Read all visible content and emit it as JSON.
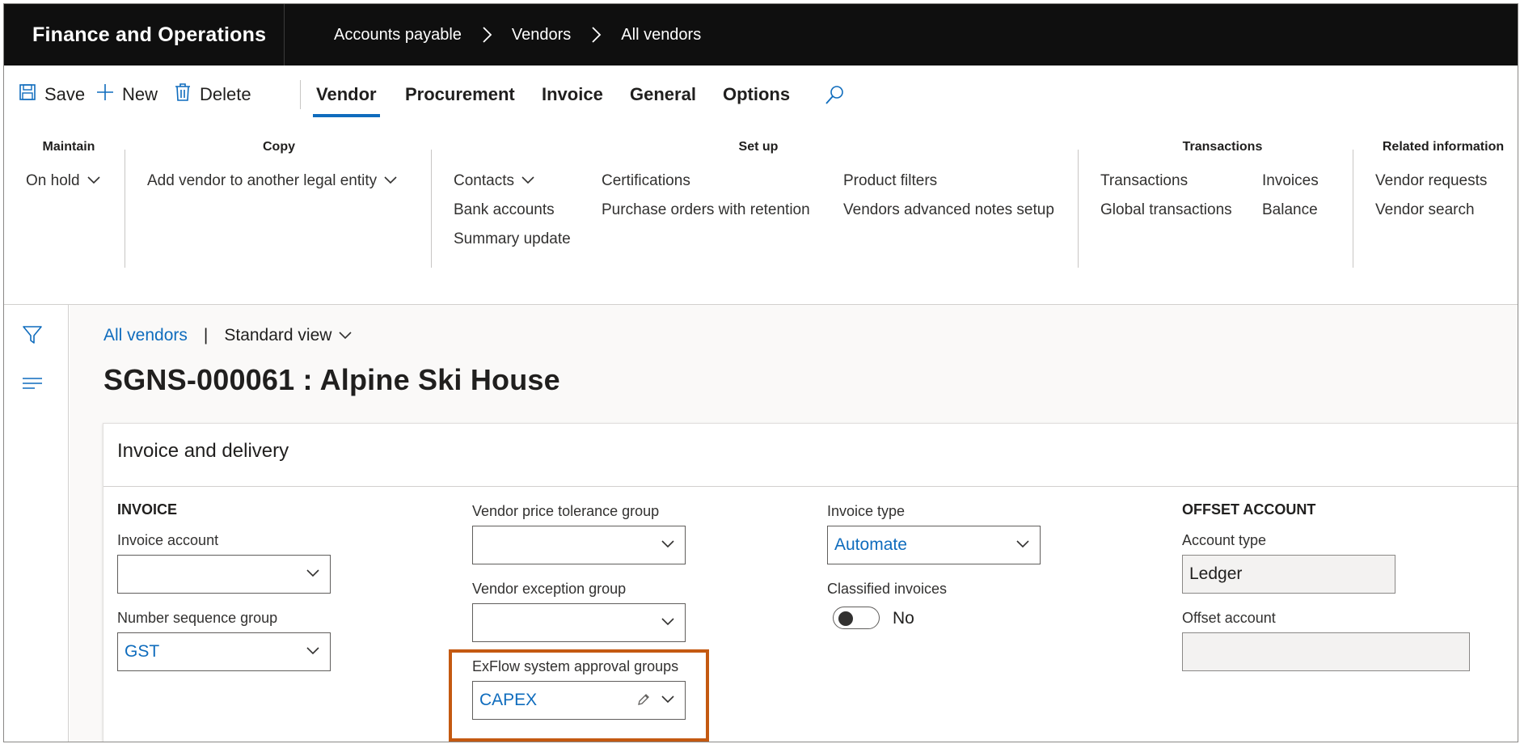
{
  "app": {
    "title": "Finance and Operations"
  },
  "breadcrumb": [
    "Accounts payable",
    "Vendors",
    "All vendors"
  ],
  "actions": {
    "save": "Save",
    "new": "New",
    "delete": "Delete"
  },
  "tabs": [
    "Vendor",
    "Procurement",
    "Invoice",
    "General",
    "Options"
  ],
  "active_tab": "Vendor",
  "ribbon": {
    "maintain": {
      "title": "Maintain",
      "items": [
        "On hold"
      ]
    },
    "copy": {
      "title": "Copy",
      "items": [
        "Add vendor to another legal entity"
      ]
    },
    "setup": {
      "title": "Set up",
      "col1": [
        "Contacts",
        "Bank accounts",
        "Summary update"
      ],
      "col2": [
        "Certifications",
        "Purchase orders with retention"
      ],
      "col3": [
        "Product filters",
        "Vendors advanced notes setup"
      ]
    },
    "transactions": {
      "title": "Transactions",
      "col1": [
        "Transactions",
        "Global transactions"
      ],
      "col2": [
        "Invoices",
        "Balance"
      ]
    },
    "related": {
      "title": "Related information",
      "items": [
        "Vendor requests",
        "Vendor search"
      ]
    }
  },
  "view": {
    "link": "All vendors",
    "pipe": "|",
    "name": "Standard view"
  },
  "record": {
    "title": "SGNS-000061 : Alpine Ski House"
  },
  "fasttab": {
    "title": "Invoice and delivery",
    "invoice": {
      "heading": "INVOICE",
      "invoice_account_label": "Invoice account",
      "invoice_account_value": "",
      "number_sequence_label": "Number sequence group",
      "number_sequence_value": "GST"
    },
    "col2": {
      "price_tolerance_label": "Vendor price tolerance group",
      "price_tolerance_value": "",
      "exception_group_label": "Vendor exception group",
      "exception_group_value": "",
      "exflow_label": "ExFlow system approval groups",
      "exflow_value": "CAPEX"
    },
    "col3": {
      "invoice_type_label": "Invoice type",
      "invoice_type_value": "Automate",
      "classified_label": "Classified invoices",
      "classified_value": "No"
    },
    "offset": {
      "heading": "OFFSET ACCOUNT",
      "account_type_label": "Account type",
      "account_type_value": "Ledger",
      "offset_account_label": "Offset account",
      "offset_account_value": ""
    }
  },
  "icons": {
    "save": "save-icon",
    "new": "plus-icon",
    "delete": "trash-icon",
    "search": "search-icon",
    "filter": "filter-icon",
    "menu": "lines-icon",
    "chevron": "chevron-down-icon",
    "edit": "pencil-icon",
    "breadcrumb_sep": "chevron-right-icon"
  },
  "colors": {
    "accent": "#0f6cbd",
    "highlight": "#c45911",
    "topbar": "#0f0f0f"
  }
}
